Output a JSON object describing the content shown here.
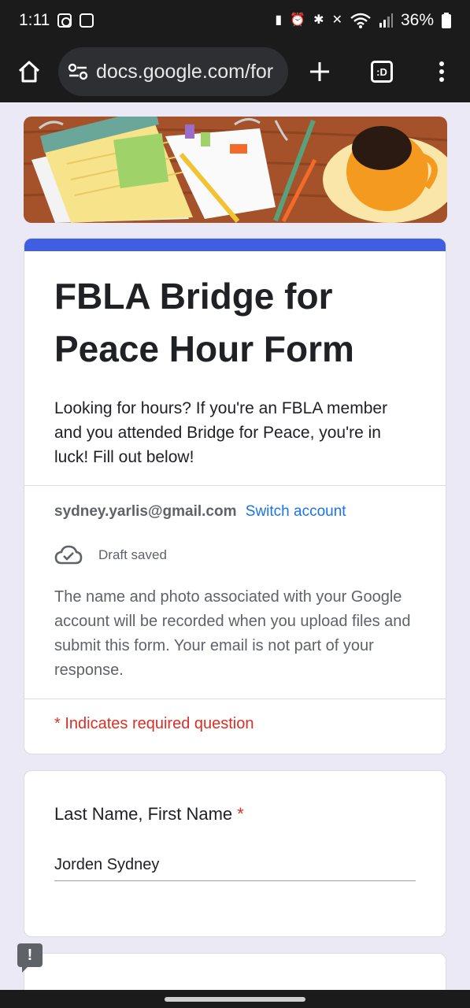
{
  "status_bar": {
    "time": "1:11",
    "battery": "36%"
  },
  "browser": {
    "url": "docs.google.com/for",
    "tabs_label": ":D"
  },
  "form": {
    "title": "FBLA Bridge for Peace Hour Form",
    "description": "Looking for hours? If you're an FBLA member and you attended Bridge for Peace, you're in luck! Fill out below!",
    "account_email": "sydney.yarlis@gmail.com",
    "switch_account_label": "Switch account",
    "draft_status": "Draft saved",
    "privacy_notice": "The name and photo associated with your Google account will be recorded when you upload files and submit this form. Your email is not part of your response.",
    "required_notice": "* Indicates required question",
    "accent_color": "#3f5ee0"
  },
  "questions": [
    {
      "label": "Last Name, First Name",
      "required_mark": "*",
      "value": "Jorden Sydney"
    }
  ],
  "feedback_icon_label": "!"
}
